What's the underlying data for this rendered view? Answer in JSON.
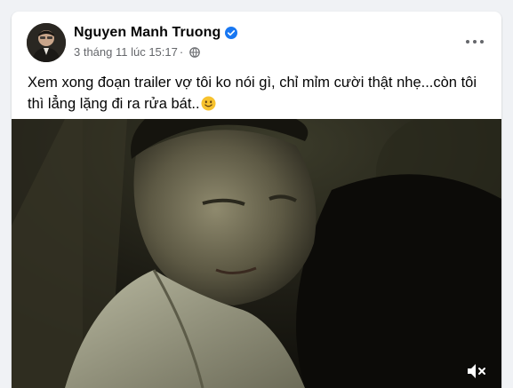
{
  "post": {
    "author_name": "Nguyen Manh Truong",
    "timestamp": "3 tháng 11 lúc 15:17",
    "caption": "Xem xong đoạn trailer vợ tôi ko nói gì, chỉ mỉm cười thật nhẹ...còn tôi thì lẳng lặng đi ra rửa bát..",
    "caption_emoji": "slightly-smiling-face-emoji",
    "verified_icon": "verified-badge-icon",
    "audience_icon": "globe-icon",
    "menu_icon": "more-options-icon",
    "video_control_icon": "muted-speaker-icon"
  },
  "colors": {
    "verified_blue": "#1877f2",
    "secondary_text": "#65676b",
    "primary_text": "#050505",
    "page_background": "#f0f2f5"
  }
}
